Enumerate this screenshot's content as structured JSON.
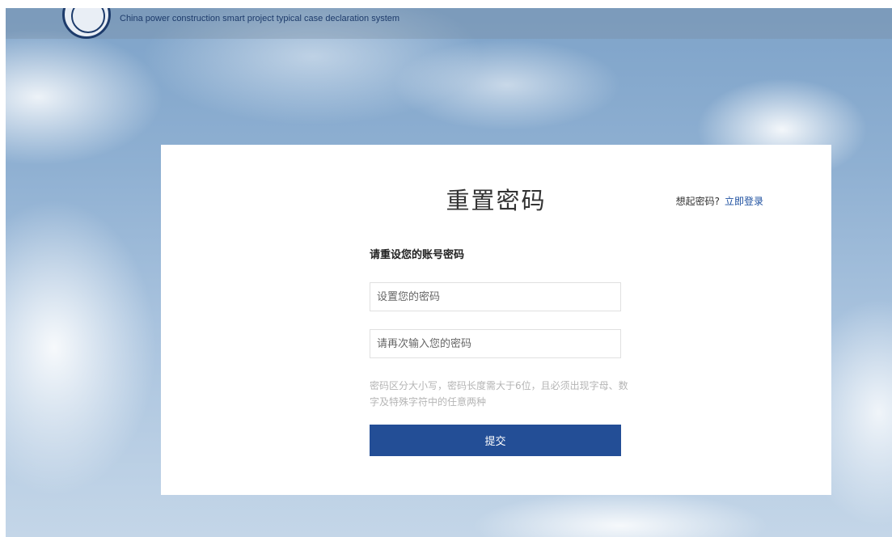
{
  "header": {
    "system_name": "China power construction smart project typical case declaration system",
    "logo_icon": "power-construction-emblem"
  },
  "form": {
    "title": "重置密码",
    "remember_prompt": "想起密码?",
    "login_link": "立即登录",
    "subtitle": "请重设您的账号密码",
    "password_placeholder": "设置您的密码",
    "confirm_placeholder": "请再次输入您的密码",
    "rule_text": "密码区分大小写，密码长度需大于6位，且必须出现字母、数字及特殊字符中的任意两种",
    "submit_label": "提交"
  },
  "colors": {
    "accent": "#234e96",
    "link": "#1e50a0",
    "hint_text": "#b5b5b5"
  }
}
